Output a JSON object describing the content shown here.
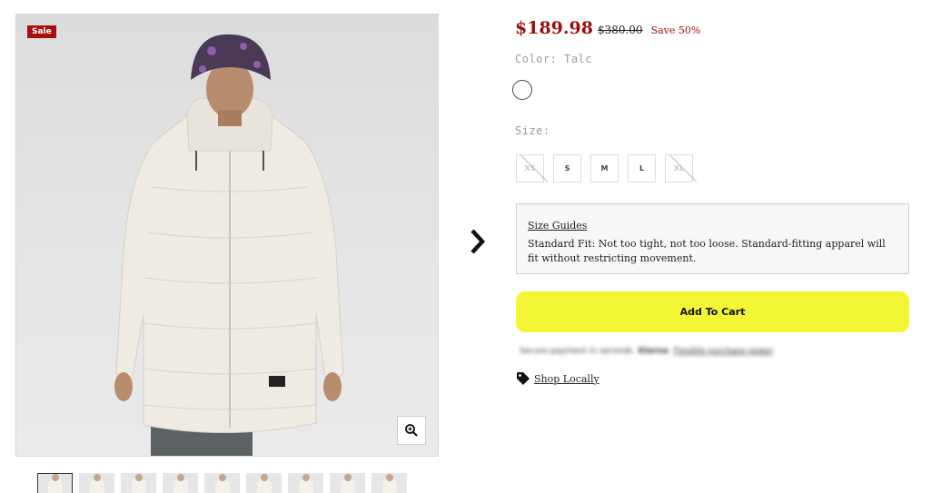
{
  "gallery": {
    "sale_badge": "Sale",
    "zoom_icon": "zoom-in-icon",
    "thumbnail_count": 9
  },
  "product": {
    "price": "$189.98",
    "original_price": "$380.00",
    "save": "Save 50%",
    "color_label": "Color:",
    "color_value": "Talc",
    "size_label": "Size:",
    "sizes": [
      {
        "label": "XS",
        "available": false
      },
      {
        "label": "S",
        "available": true
      },
      {
        "label": "M",
        "available": true
      },
      {
        "label": "L",
        "available": true
      },
      {
        "label": "XL",
        "available": false
      }
    ],
    "size_guide": {
      "link": "Size Guides",
      "text": "Standard Fit: Not too tight, not too loose. Standard-fitting apparel will fit without restricting movement."
    },
    "add_to_cart": "Add To Cart",
    "secure_payment": {
      "text": "Secure payment in seconds",
      "brand": "Klarna",
      "link": "Flexible purchase power"
    },
    "shop_locally": "Shop Locally"
  },
  "colors": {
    "sale_red": "#a80f0f",
    "price_red": "#9a0e0e",
    "cart_yellow": "#f2f634"
  }
}
